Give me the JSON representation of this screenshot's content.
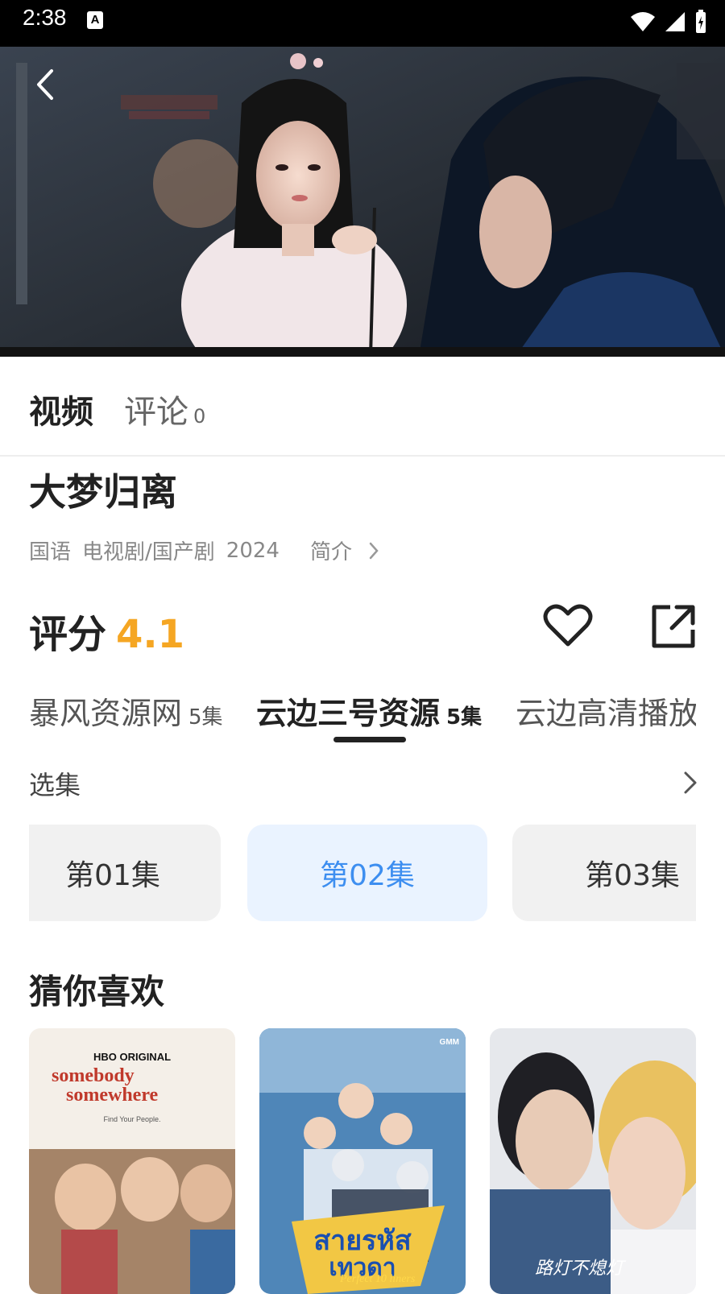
{
  "status_bar": {
    "time": "2:38",
    "a_badge": "A"
  },
  "tabs": {
    "video": "视频",
    "comments": "评论",
    "comments_count": "0"
  },
  "show": {
    "title": "大梦归离",
    "language": "国语",
    "genre": "电视剧/国产剧",
    "year": "2024",
    "intro_label": "简介"
  },
  "rating": {
    "label": "评分",
    "score": "4.1"
  },
  "sources": [
    {
      "name": "暴风资源网",
      "eps": "5集"
    },
    {
      "name": "云边三号资源",
      "eps": "5集"
    },
    {
      "name": "云边高清播放",
      "eps": ""
    }
  ],
  "episodes": {
    "header": "选集",
    "items": [
      "第01集",
      "第02集",
      "第03集"
    ],
    "selected": "第02集"
  },
  "recommend": {
    "title": "猜你喜欢",
    "items": [
      {
        "poster_brand": "HBO ORIGINAL",
        "poster_title_1": "somebody",
        "poster_title_2": "somewhere",
        "poster_tagline": "Find Your People."
      },
      {
        "poster_brand": "GMM",
        "poster_title_1": "สายรหัส",
        "poster_title_2": "เทวดา",
        "poster_sub": "Perfect 10 liners"
      },
      {
        "poster_title_1": "路灯不熄灯"
      }
    ]
  },
  "colors": {
    "accent": "#3d8ef0",
    "score": "#f5a623",
    "active_episode_bg": "#eaf3ff"
  }
}
